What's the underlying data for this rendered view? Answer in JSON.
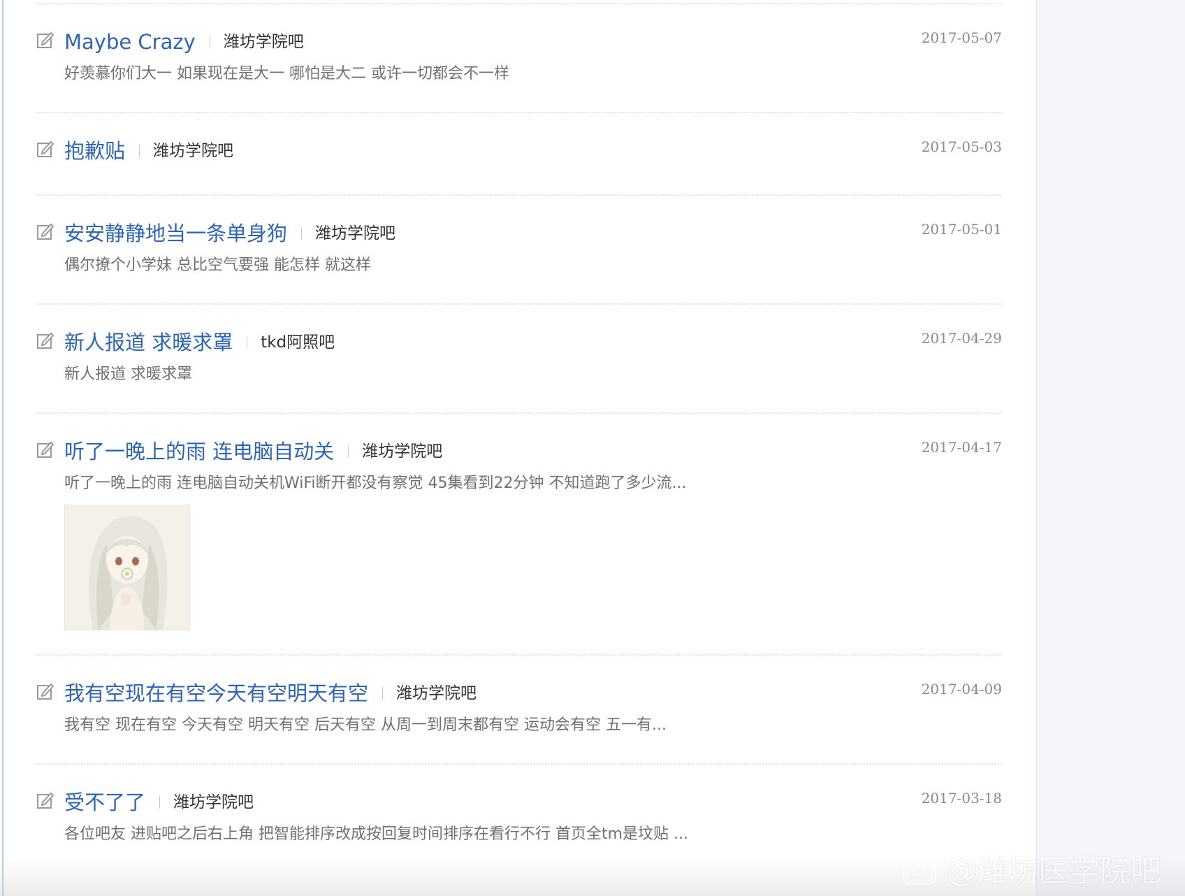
{
  "posts": [
    {
      "title": "Maybe Crazy",
      "forum": "潍坊学院吧",
      "date": "2017-05-07",
      "snippet": "好羡慕你们大一 如果现在是大一 哪怕是大二 或许一切都会不一样"
    },
    {
      "title": "抱歉贴",
      "forum": "潍坊学院吧",
      "date": "2017-05-03",
      "snippet": ""
    },
    {
      "title": "安安静静地当一条单身狗",
      "forum": "潍坊学院吧",
      "date": "2017-05-01",
      "snippet": "偶尔撩个小学妹 总比空气要强 能怎样 就这样"
    },
    {
      "title": "新人报道 求暖求罩",
      "forum": "tkd阿照吧",
      "date": "2017-04-29",
      "snippet": "新人报道 求暖求罩"
    },
    {
      "title": "听了一晚上的雨 连电脑自动关",
      "forum": "潍坊学院吧",
      "date": "2017-04-17",
      "snippet": "听了一晚上的雨 连电脑自动关机WiFi断开都没有察觉 45集看到22分钟 不知道跑了多少流..."
    },
    {
      "title": "我有空现在有空今天有空明天有空",
      "forum": "潍坊学院吧",
      "date": "2017-04-09",
      "snippet": "我有空 现在有空 今天有空 明天有空 后天有空 从周一到周末都有空 运动会有空 五一有..."
    },
    {
      "title": "受不了了",
      "forum": "潍坊学院吧",
      "date": "2017-03-18",
      "snippet": "各位吧友 进贴吧之后右上角 把智能排序改成按回复时间排序在看行不行 首页全tm是坟贴 ..."
    }
  ],
  "icons": {
    "post": "edit-icon",
    "thumbnail": "anime-girl-thumbnail",
    "watermark_logo": "weibo-camera-icon"
  },
  "watermark": {
    "text": "@潍坊医学院吧"
  },
  "colors": {
    "title": "#2d64b3",
    "forum": "#333333",
    "snippet": "#707070",
    "date": "#8a8a8a",
    "divider": "#e3e3e3",
    "side_panel": "#f4f6fa"
  }
}
